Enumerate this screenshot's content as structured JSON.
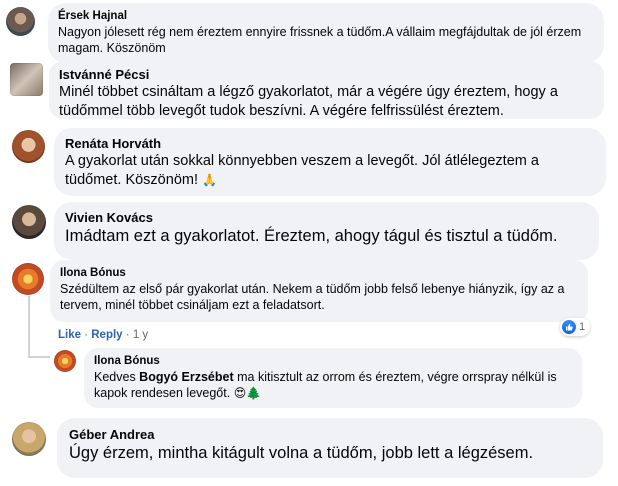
{
  "comments": [
    {
      "name": "Érsek Hajnal",
      "text": "Nagyon jólesett rég nem éreztem ennyire frissnek a tüdőm.A vállaim megfájdultak de jól érzem magam. Köszönöm"
    },
    {
      "name": "Istvánné Pécsi",
      "text": "Minél többet csináltam a légző gyakorlatot, már a végére úgy éreztem, hogy a tüdőmmel több levegőt tudok beszívni. A végére felfrissülést éreztem."
    },
    {
      "name": "Renáta Horváth",
      "text": "A gyakorlat után sokkal könnyebben veszem a levegőt. Jól átlélegeztem a tüdőmet. Köszönöm!",
      "emoji": "🙏"
    },
    {
      "name": "Vivien Kovács",
      "text": "Imádtam ezt a gyakorlatot. Éreztem, ahogy tágul és tisztul a tüdőm."
    },
    {
      "name": "Ilona Bónus",
      "text": "Szédültem az első pár gyakorlat után. Nekem a tüdőm jobb felső lebenye hiányzik, így az a tervem, minél többet csináljam ezt a feladatsort.",
      "like_label": "Like",
      "reply_label": "Reply",
      "separator": " · ",
      "age": "1 y",
      "reaction_count": "1"
    },
    {
      "name": "Géber Andrea",
      "text": "Úgy érzem, mintha kitágult volna a tüdőm, jobb lett a légzésem."
    }
  ],
  "reply": {
    "name": "Ilona Bónus",
    "text_prefix": "Kedves ",
    "mention": "Bogyó Erzsébet",
    "text_suffix": " ma kitisztult az orrom és éreztem, végre orrspray nélkül is kapok rendesen levegőt.",
    "emoji": "😍🌲"
  },
  "icons": {
    "like": "like-icon",
    "reaction_accent": "#1877f2"
  }
}
